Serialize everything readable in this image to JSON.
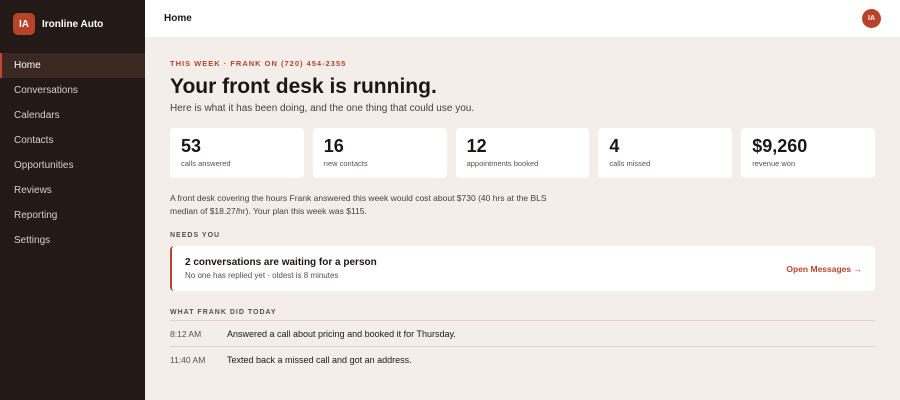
{
  "brand": {
    "logo": "IA",
    "name": "Ironline Auto"
  },
  "nav": [
    {
      "label": "Home",
      "active": true
    },
    {
      "label": "Conversations"
    },
    {
      "label": "Calendars"
    },
    {
      "label": "Contacts"
    },
    {
      "label": "Opportunities"
    },
    {
      "label": "Reviews"
    },
    {
      "label": "Reporting"
    },
    {
      "label": "Settings"
    }
  ],
  "topbar": {
    "title": "Home",
    "avatar": "IA"
  },
  "hero": {
    "eyebrow": "THIS WEEK · FRANK ON (720) 454-2355",
    "headline": "Your front desk is running.",
    "subline": "Here is what it has been doing, and the one thing that could use you."
  },
  "stats": [
    {
      "value": "53",
      "label": "calls answered"
    },
    {
      "value": "16",
      "label": "new contacts"
    },
    {
      "value": "12",
      "label": "appointments booked"
    },
    {
      "value": "4",
      "label": "calls missed"
    },
    {
      "value": "$9,260",
      "label": "revenue won"
    }
  ],
  "cost_note": {
    "line1": "A front desk covering the hours Frank answered this week would cost about $730 (40 hrs at the BLS",
    "line2": "median of $18.27/hr). Your plan this week was $115."
  },
  "needs_you": {
    "label": "NEEDS YOU",
    "title": "2 conversations are waiting for a person",
    "subtitle": "No one has replied yet · oldest is 8 minutes",
    "link": "Open Messages →"
  },
  "activity": {
    "label": "WHAT FRANK DID TODAY",
    "items": [
      {
        "time": "8:12 AM",
        "text": "Answered a call about pricing and booked it for Thursday."
      },
      {
        "time": "11:40 AM",
        "text": "Texted back a missed call and got an address."
      }
    ]
  },
  "colors": {
    "accent": "#b8432a",
    "sidebar": "#231a17",
    "background": "#f3eee9"
  }
}
